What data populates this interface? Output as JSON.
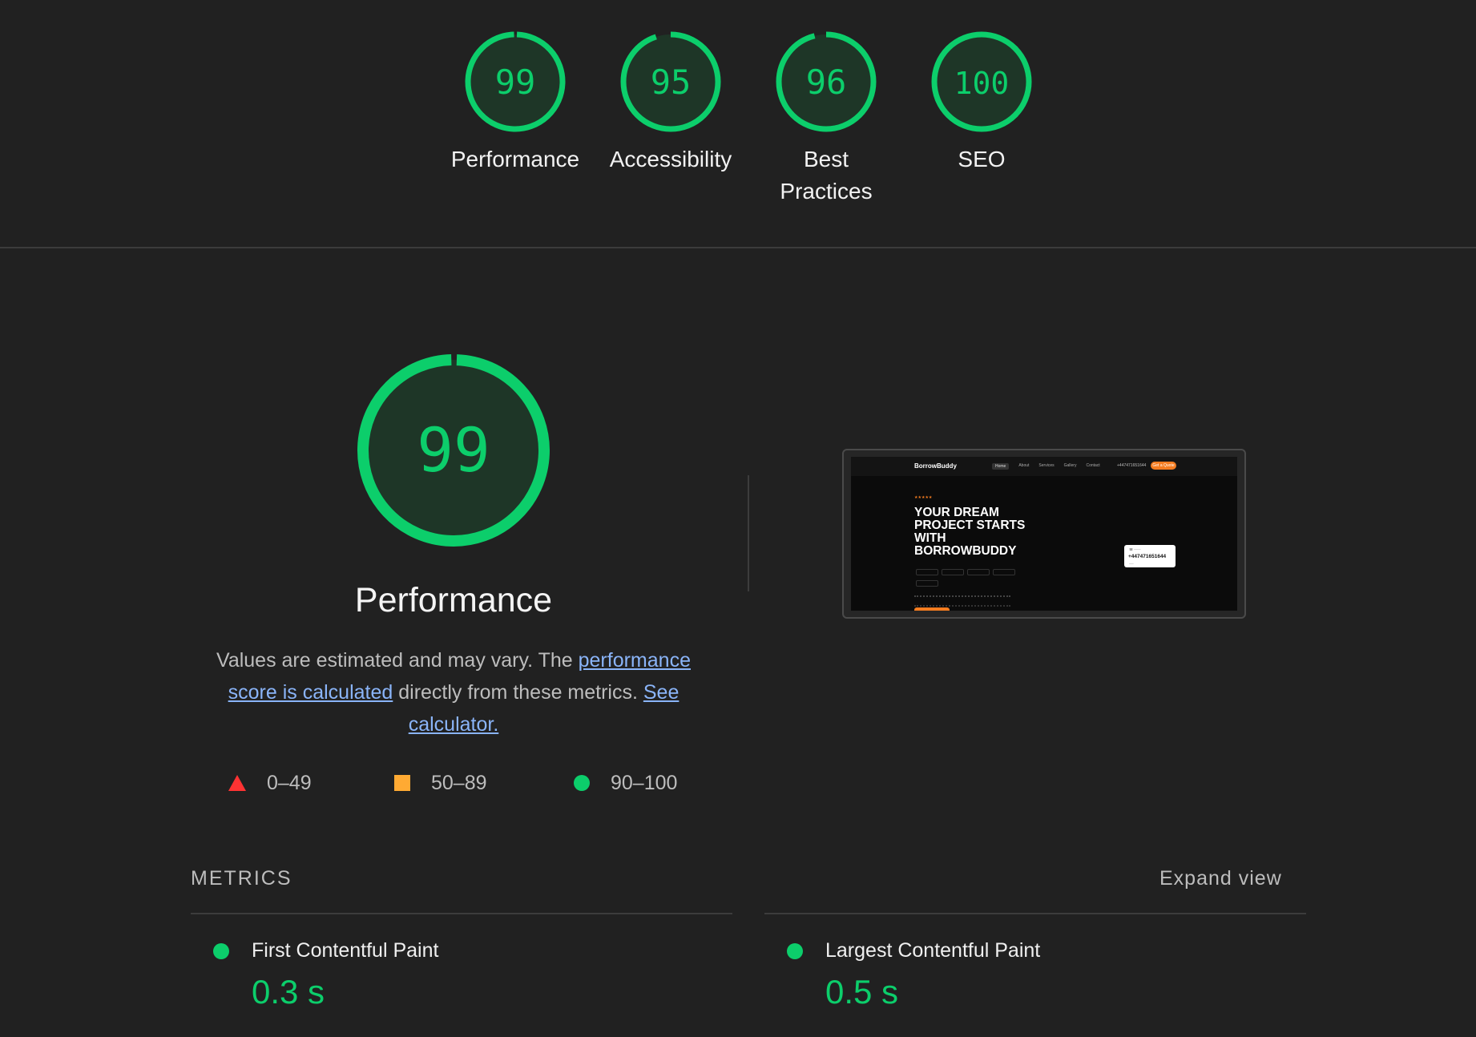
{
  "colors": {
    "pass": "#0cce6b",
    "average": "#ffaa33",
    "fail": "#ff3333",
    "link": "#8ab4f8",
    "background": "#212121"
  },
  "gauges": [
    {
      "score": "99",
      "label": "Performance"
    },
    {
      "score": "95",
      "label": "Accessibility"
    },
    {
      "score": "96",
      "label": "Best Practices"
    },
    {
      "score": "100",
      "label": "SEO"
    }
  ],
  "performance": {
    "score": "99",
    "title": "Performance",
    "desc_prefix": "Values are estimated and may vary. The ",
    "desc_link1": "performance score is calculated",
    "desc_middle": " directly from these metrics. ",
    "desc_link2": "See calculator."
  },
  "legend": [
    {
      "icon": "triangle-icon",
      "range": "0–49"
    },
    {
      "icon": "square-icon",
      "range": "50–89"
    },
    {
      "icon": "circle-icon",
      "range": "90–100"
    }
  ],
  "screenshot": {
    "brand": "BorrowBuddy",
    "nav": [
      "Home",
      "About",
      "Services",
      "Gallery",
      "Contact"
    ],
    "phone": "+447471651644",
    "cta": "Get a Quote",
    "stars": "★★★★★",
    "headline": "YOUR DREAM PROJECT STARTS WITH BORROWBUDDY",
    "card_number": "+447471651644"
  },
  "metrics": {
    "heading": "METRICS",
    "expand_label": "Expand view",
    "items": [
      {
        "name": "First Contentful Paint",
        "value": "0.3 s"
      },
      {
        "name": "Largest Contentful Paint",
        "value": "0.5 s"
      }
    ]
  }
}
